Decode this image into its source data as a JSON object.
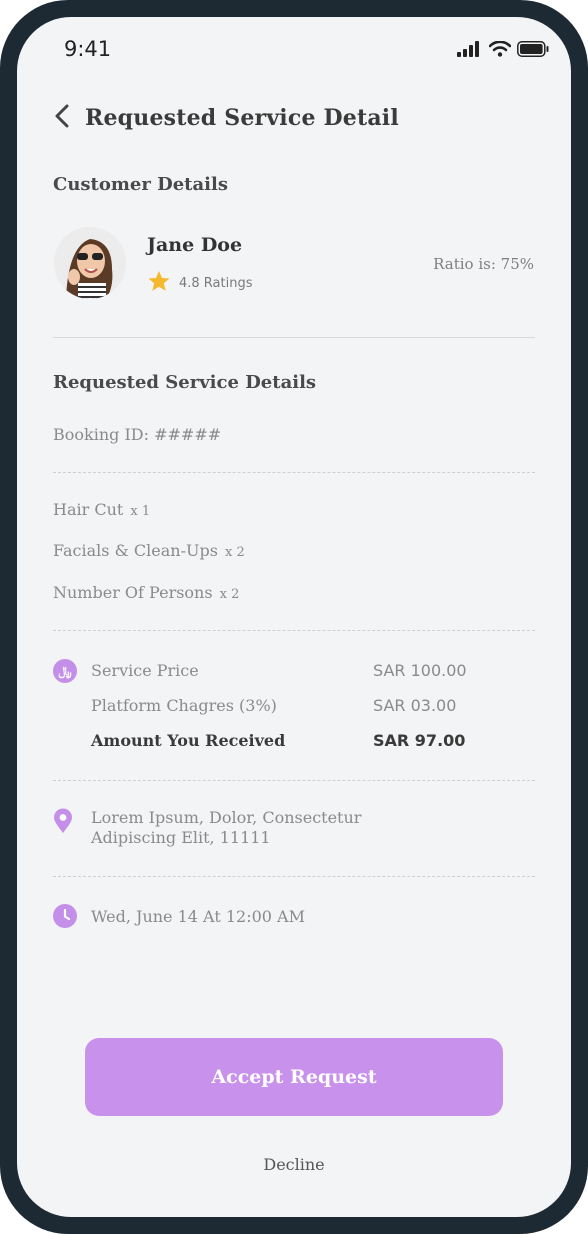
{
  "status_bar": {
    "time": "9:41"
  },
  "header": {
    "title": "Requested Service Detail"
  },
  "customer": {
    "section_title": "Customer Details",
    "name": "Jane Doe",
    "rating_text": "4.8 Ratings",
    "ratio_text": "Ratio is: 75%"
  },
  "service": {
    "section_title": "Requested Service Details",
    "booking_id": "Booking ID: #####",
    "items": [
      {
        "name": "Hair Cut",
        "qty": "x 1"
      },
      {
        "name": "Facials & Clean-Ups",
        "qty": "x 2"
      },
      {
        "name": "Number Of Persons",
        "qty": "x 2"
      }
    ]
  },
  "pricing": {
    "rows": [
      {
        "label": "Service Price",
        "value": "SAR 100.00"
      },
      {
        "label": "Platform Chagres (3%)",
        "value": "SAR 03.00"
      },
      {
        "label": "Amount You Received",
        "value": "SAR 97.00"
      }
    ]
  },
  "location": {
    "line1": "Lorem Ipsum, Dolor, Consectetur",
    "line2": "Adipiscing Elit, 11111"
  },
  "schedule": {
    "datetime": "Wed, June 14 At 12:00 AM"
  },
  "actions": {
    "accept_label": "Accept Request",
    "decline_label": "Decline"
  },
  "colors": {
    "accent": "#c892ec",
    "icon_bg": "#c48fe8",
    "star": "#f5b82e"
  },
  "icons": [
    "back-chevron-icon",
    "signal-icon",
    "wifi-icon",
    "battery-icon",
    "star-icon",
    "currency-icon",
    "location-pin-icon",
    "clock-icon"
  ]
}
